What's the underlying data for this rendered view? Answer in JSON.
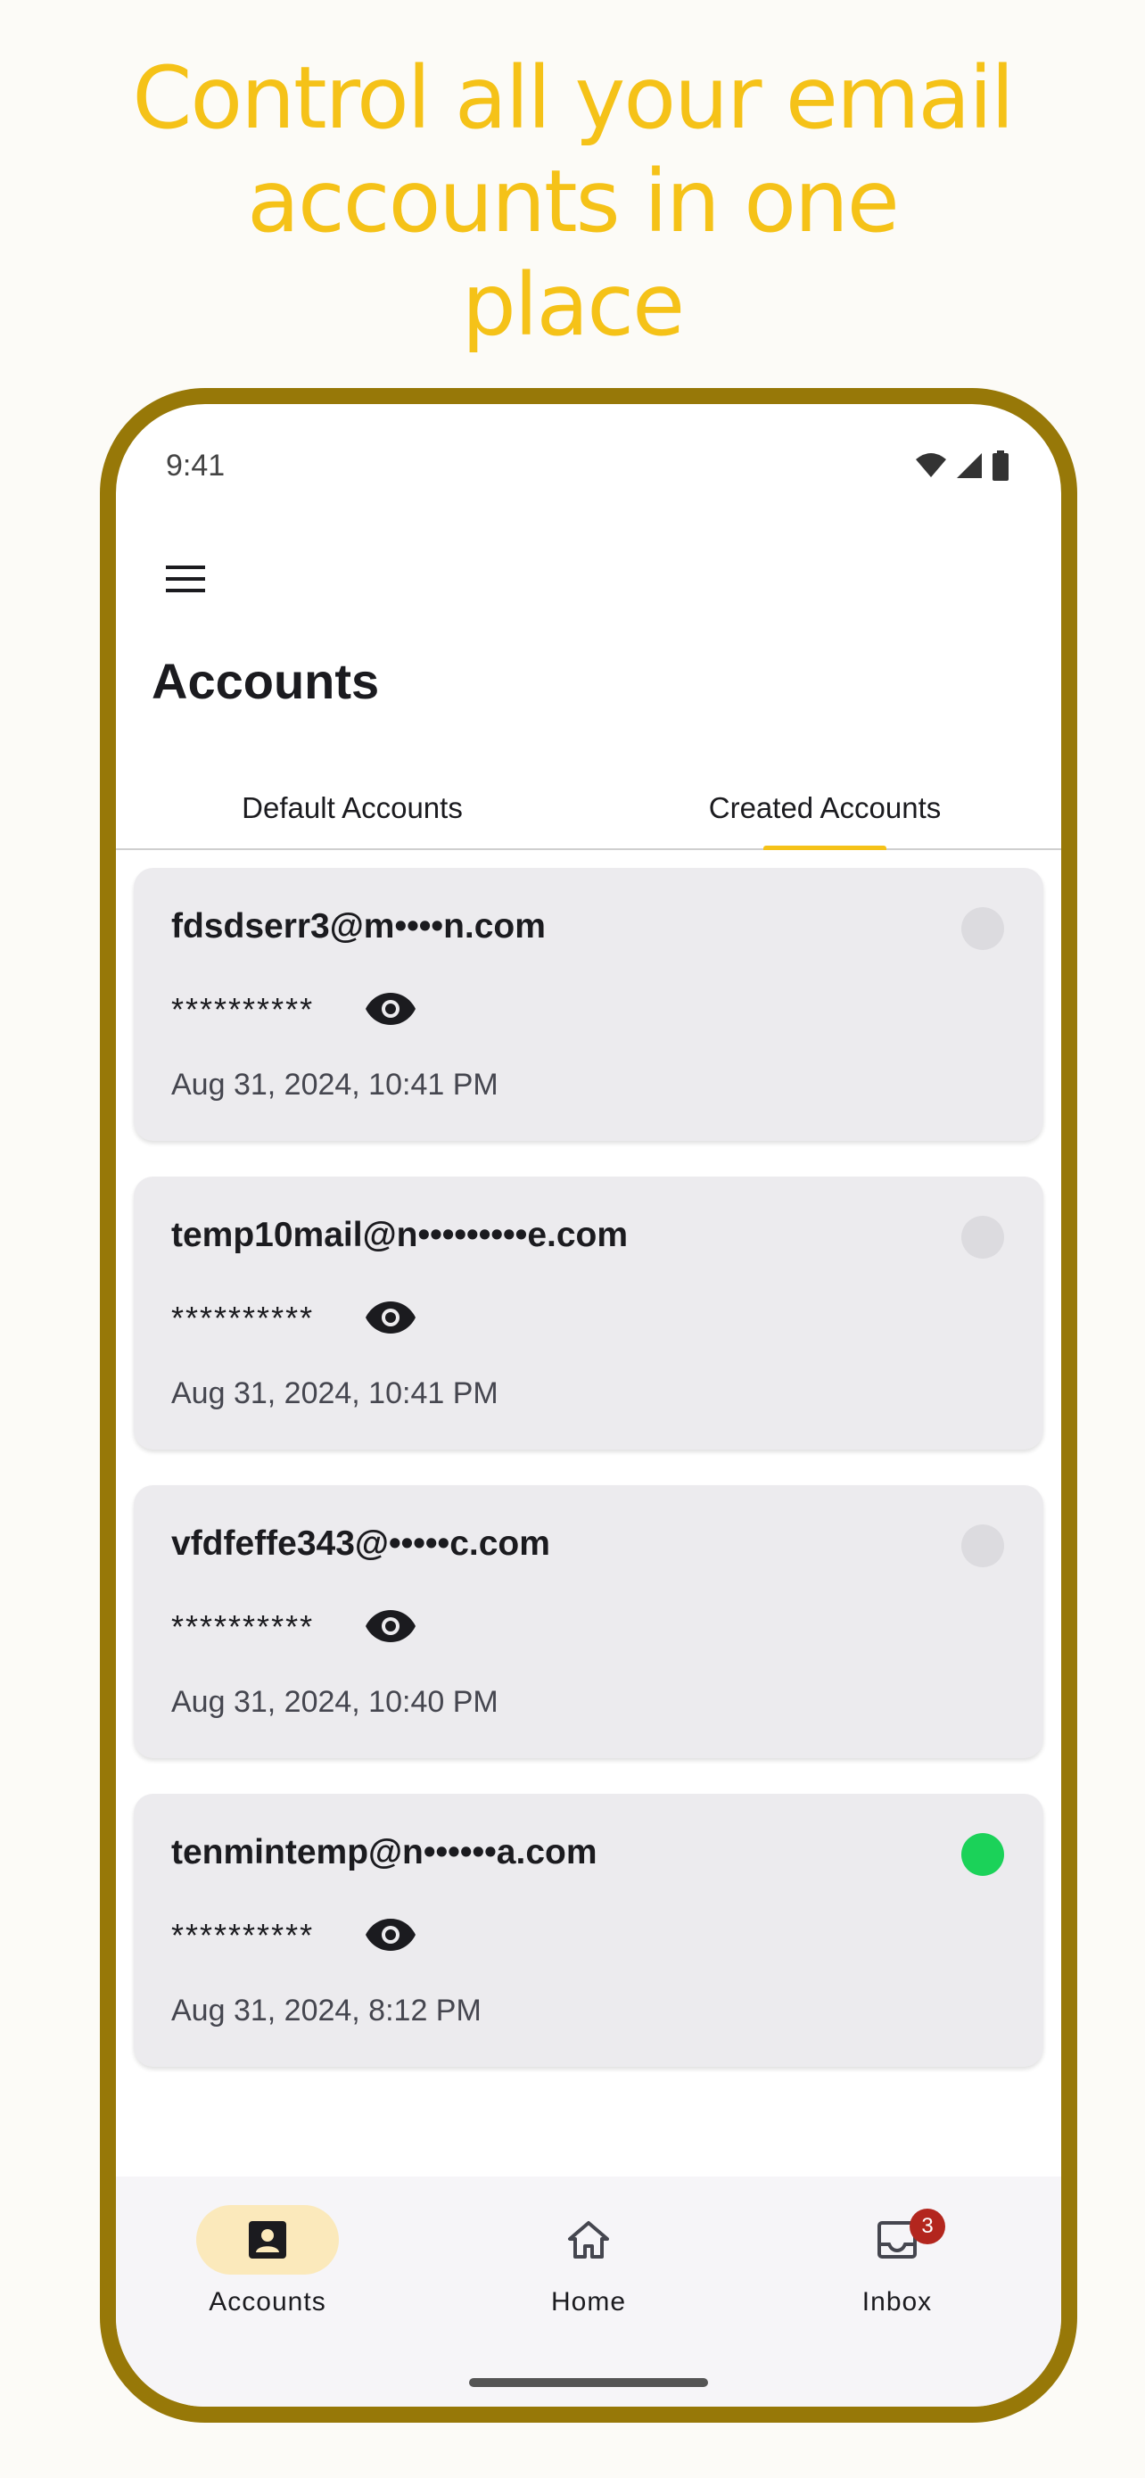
{
  "promo": {
    "line1": "Control all your email",
    "line2": "accounts in one",
    "line3": "place"
  },
  "status_bar": {
    "time": "9:41",
    "icons": [
      "wifi-icon",
      "cellular-signal-icon",
      "battery-icon"
    ]
  },
  "header": {
    "menu_icon": "hamburger-menu-icon",
    "title": "Accounts"
  },
  "tabs": [
    {
      "label": "Default Accounts",
      "selected": false
    },
    {
      "label": "Created Accounts",
      "selected": true
    }
  ],
  "accounts": [
    {
      "email": "fdsdserr3@m••••n.com",
      "password": "**********",
      "date": "Aug 31, 2024, 10:41 PM",
      "active": false
    },
    {
      "email": "temp10mail@n•••••••••e.com",
      "password": "**********",
      "date": "Aug 31, 2024, 10:41 PM",
      "active": false
    },
    {
      "email": "vfdfeffe343@•••••c.com",
      "password": "**********",
      "date": "Aug 31, 2024, 10:40 PM",
      "active": false
    },
    {
      "email": "tenmintemp@n••••••a.com",
      "password": "**********",
      "date": "Aug 31, 2024, 8:12 PM",
      "active": true
    }
  ],
  "bottom_nav": [
    {
      "label": "Accounts",
      "icon": "account-box-icon",
      "selected": true
    },
    {
      "label": "Home",
      "icon": "home-icon",
      "selected": false
    },
    {
      "label": "Inbox",
      "icon": "inbox-icon",
      "selected": false,
      "badge": "3"
    }
  ],
  "colors": {
    "accent": "#f5c218",
    "frame": "#977808",
    "active_status": "#1bd259",
    "inactive_status": "#dcdbdf",
    "badge": "#b3261e"
  }
}
